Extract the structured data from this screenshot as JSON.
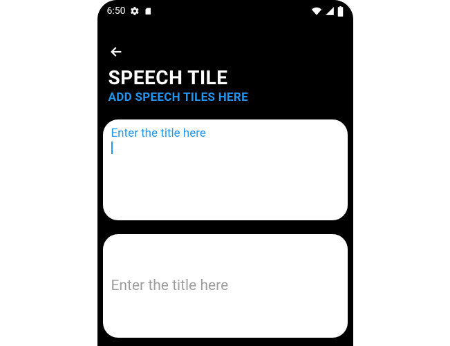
{
  "statusBar": {
    "time": "6:50",
    "icons": {
      "settings": "gear",
      "sim": "sim",
      "wifi": "wifi",
      "signal": "signal",
      "battery": "battery"
    }
  },
  "appBar": {
    "title": "SPEECH TILE",
    "subtitle": "ADD SPEECH TILES HERE"
  },
  "tiles": [
    {
      "placeholder": "Enter the title here",
      "focused": true,
      "value": ""
    },
    {
      "placeholder": "Enter the title here",
      "focused": false,
      "value": ""
    }
  ],
  "colors": {
    "background": "#000000",
    "card": "#ffffff",
    "accent": "#2196f3",
    "hint": "#9e9e9e"
  }
}
